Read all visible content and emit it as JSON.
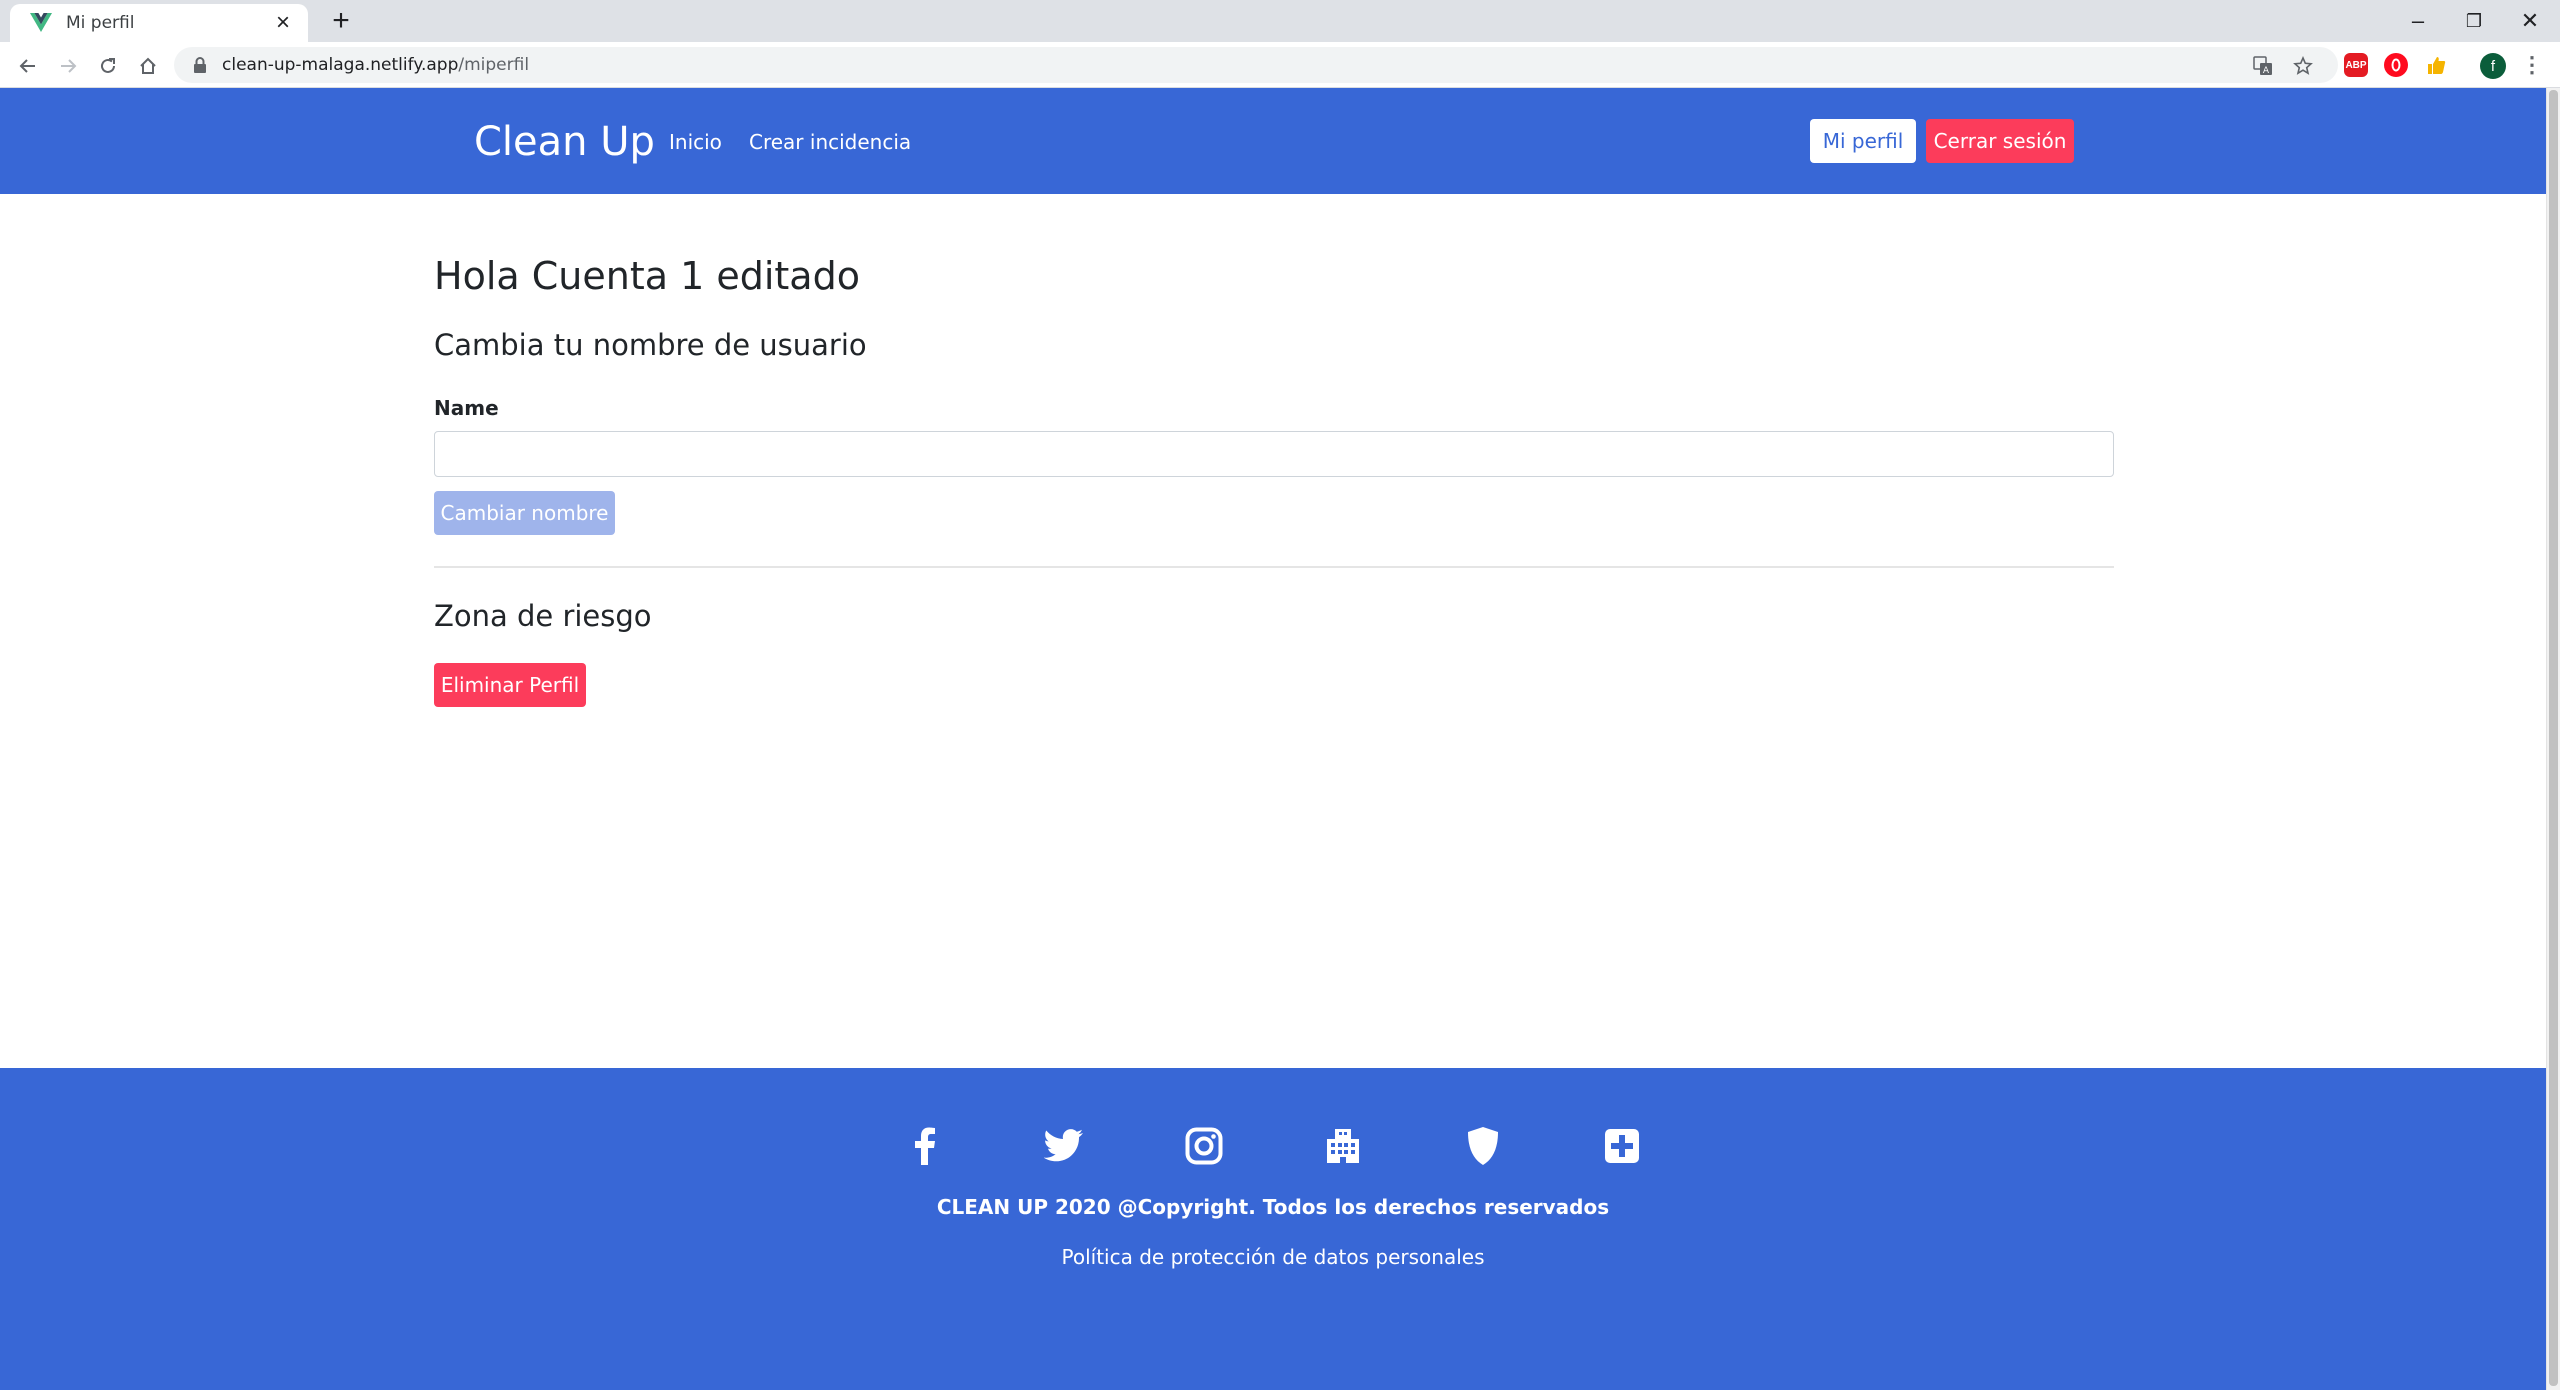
{
  "browser": {
    "tab_title": "Mi perfil",
    "url_host": "clean-up-malaga.netlify.app",
    "url_path": "/miperfil",
    "profile_initial": "f"
  },
  "navbar": {
    "brand": "Clean Up",
    "links": [
      "Inicio",
      "Crear incidencia"
    ],
    "profile_button": "Mi perfil",
    "logout_button": "Cerrar sesión"
  },
  "main": {
    "greeting": "Hola Cuenta 1 editado",
    "change_name_heading": "Cambia tu nombre de usuario",
    "name_label": "Name",
    "name_value": "",
    "change_name_button": "Cambiar nombre",
    "risk_heading": "Zona de riesgo",
    "delete_button": "Eliminar Perfil"
  },
  "footer": {
    "social_icons": [
      "facebook-icon",
      "twitter-icon",
      "instagram-icon",
      "building-icon",
      "shield-icon",
      "plus-square-icon"
    ],
    "copyright": "CLEAN UP 2020 @Copyright. Todos los derechos reservados",
    "privacy_link": "Política de protección de datos personales"
  },
  "colors": {
    "primary": "#3867d6",
    "danger": "#fc3c5b",
    "disabled_primary": "#9fb4eb"
  }
}
